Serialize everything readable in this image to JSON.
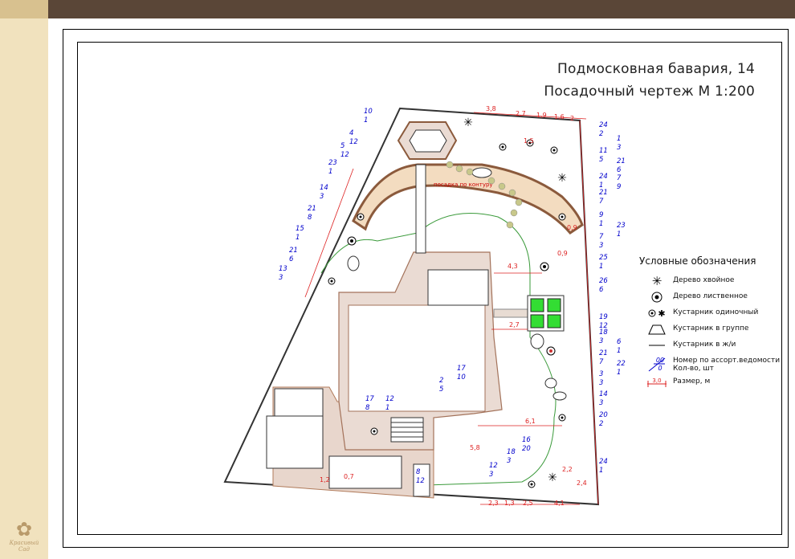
{
  "title": {
    "line1": "Подмосковная бавария, 14",
    "line2": "Посадочный чертеж М 1:200"
  },
  "logo": {
    "name": "Красивый Сад"
  },
  "plan": {
    "path_label": "посадка по контуру",
    "callouts": [
      {
        "num": "10",
        "qty": "1"
      },
      {
        "num": "4",
        "qty": "12"
      },
      {
        "num": "5",
        "qty": "12"
      },
      {
        "num": "23",
        "qty": "1"
      },
      {
        "num": "14",
        "qty": "3"
      },
      {
        "num": "21",
        "qty": "8"
      },
      {
        "num": "15",
        "qty": "1"
      },
      {
        "num": "21",
        "qty": "6"
      },
      {
        "num": "13",
        "qty": "3"
      },
      {
        "num": "24",
        "qty": "2"
      },
      {
        "num": "1",
        "qty": "3"
      },
      {
        "num": "11",
        "qty": "5"
      },
      {
        "num": "21",
        "qty": "6"
      },
      {
        "num": "24",
        "qty": "1"
      },
      {
        "num": "7",
        "qty": "9"
      },
      {
        "num": "21",
        "qty": "7"
      },
      {
        "num": "9",
        "qty": "1"
      },
      {
        "num": "23",
        "qty": "1"
      },
      {
        "num": "7",
        "qty": "3"
      },
      {
        "num": "25",
        "qty": "1"
      },
      {
        "num": "26",
        "qty": "6"
      },
      {
        "num": "19",
        "qty": "12"
      },
      {
        "num": "18",
        "qty": "3"
      },
      {
        "num": "6",
        "qty": "1"
      },
      {
        "num": "21",
        "qty": "7"
      },
      {
        "num": "22",
        "qty": "1"
      },
      {
        "num": "3",
        "qty": "3"
      },
      {
        "num": "14",
        "qty": "3"
      },
      {
        "num": "20",
        "qty": "2"
      },
      {
        "num": "24",
        "qty": "1"
      },
      {
        "num": "17",
        "qty": "10"
      },
      {
        "num": "2",
        "qty": "5"
      },
      {
        "num": "17",
        "qty": "8"
      },
      {
        "num": "12",
        "qty": "1"
      },
      {
        "num": "16",
        "qty": "20"
      },
      {
        "num": "18",
        "qty": "3"
      },
      {
        "num": "12",
        "qty": "3"
      },
      {
        "num": "8",
        "qty": "12"
      }
    ],
    "dimensions": [
      "3,8",
      "2,7",
      "1,9",
      "1,6",
      "2",
      "4,3",
      "2,7",
      "6,1",
      "5,8",
      "2,3",
      "1,3",
      "2,5",
      "4,1",
      "2,4",
      "0,9",
      "0,9",
      "1,5",
      "2,2",
      "0,7",
      "1,2"
    ]
  },
  "legend": {
    "heading": "Условные обозначения",
    "items": [
      {
        "label": "Дерево хвойное",
        "icon": "conifer-tree-icon"
      },
      {
        "label": "Дерево лиственное",
        "icon": "deciduous-tree-icon"
      },
      {
        "label": "Кустарник одиночный",
        "icon": "single-shrub-icon"
      },
      {
        "label": "Кустарник в группе",
        "icon": "shrub-group-icon"
      },
      {
        "label": "Кустарник в ж/и",
        "icon": "hedge-line-icon"
      },
      {
        "label": "Номер по ассорт.ведомости",
        "label2": "Кол-во, шт",
        "num": "00",
        "qty": "0",
        "icon": "assortment-number-icon"
      },
      {
        "label": "Размер, м",
        "dim": "3,0",
        "icon": "dimension-icon"
      }
    ]
  }
}
